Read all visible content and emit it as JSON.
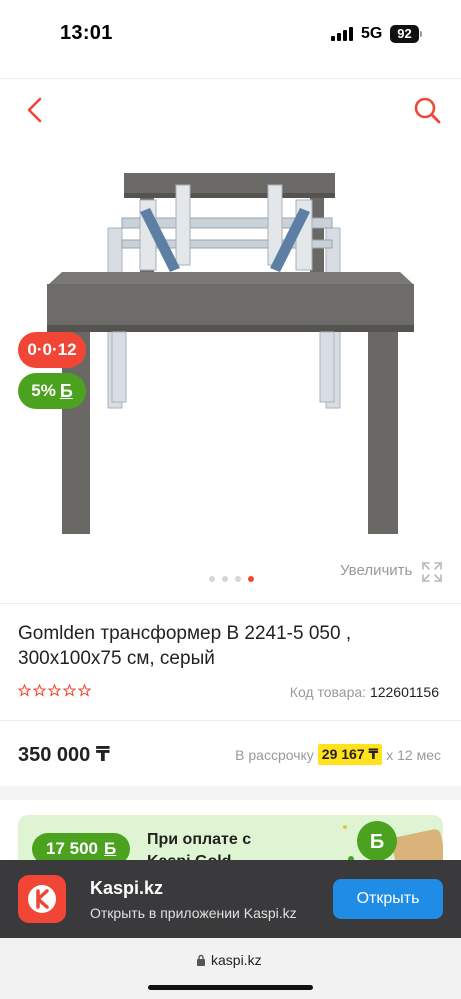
{
  "status_bar": {
    "time": "13:01",
    "network": "5G",
    "battery": "92"
  },
  "header": {
    "back_icon": "chevron-left-icon",
    "search_icon": "search-icon",
    "accent_color": "#f14635"
  },
  "gallery": {
    "badge_installment": "0·0·12",
    "badge_bonus_percent": "5%",
    "badge_bonus_symbol": "Б",
    "dots_total": 4,
    "dots_active_index": 3,
    "zoom_label": "Увеличить",
    "zoom_icon": "expand-icon"
  },
  "product": {
    "title": "Gomlden трансформер В 2241-5 050 , 300х100х75 см, серый",
    "rating_stars": 5,
    "rating_value": 0,
    "sku_label": "Код товара:",
    "sku_value": "122601156",
    "price": "350 000 ₸",
    "installment_prefix": "В рассрочку",
    "installment_amount": "29 167 ₸",
    "installment_suffix": "х 12 мес"
  },
  "promo": {
    "bonus_amount": "17 500",
    "bonus_symbol": "Б",
    "text": "При оплате с Kaspi Gold"
  },
  "app_banner": {
    "name": "Kaspi.kz",
    "subtitle": "Открыть в приложении Kaspi.kz",
    "open_label": "Открыть"
  },
  "browser": {
    "url": "kaspi.kz"
  }
}
